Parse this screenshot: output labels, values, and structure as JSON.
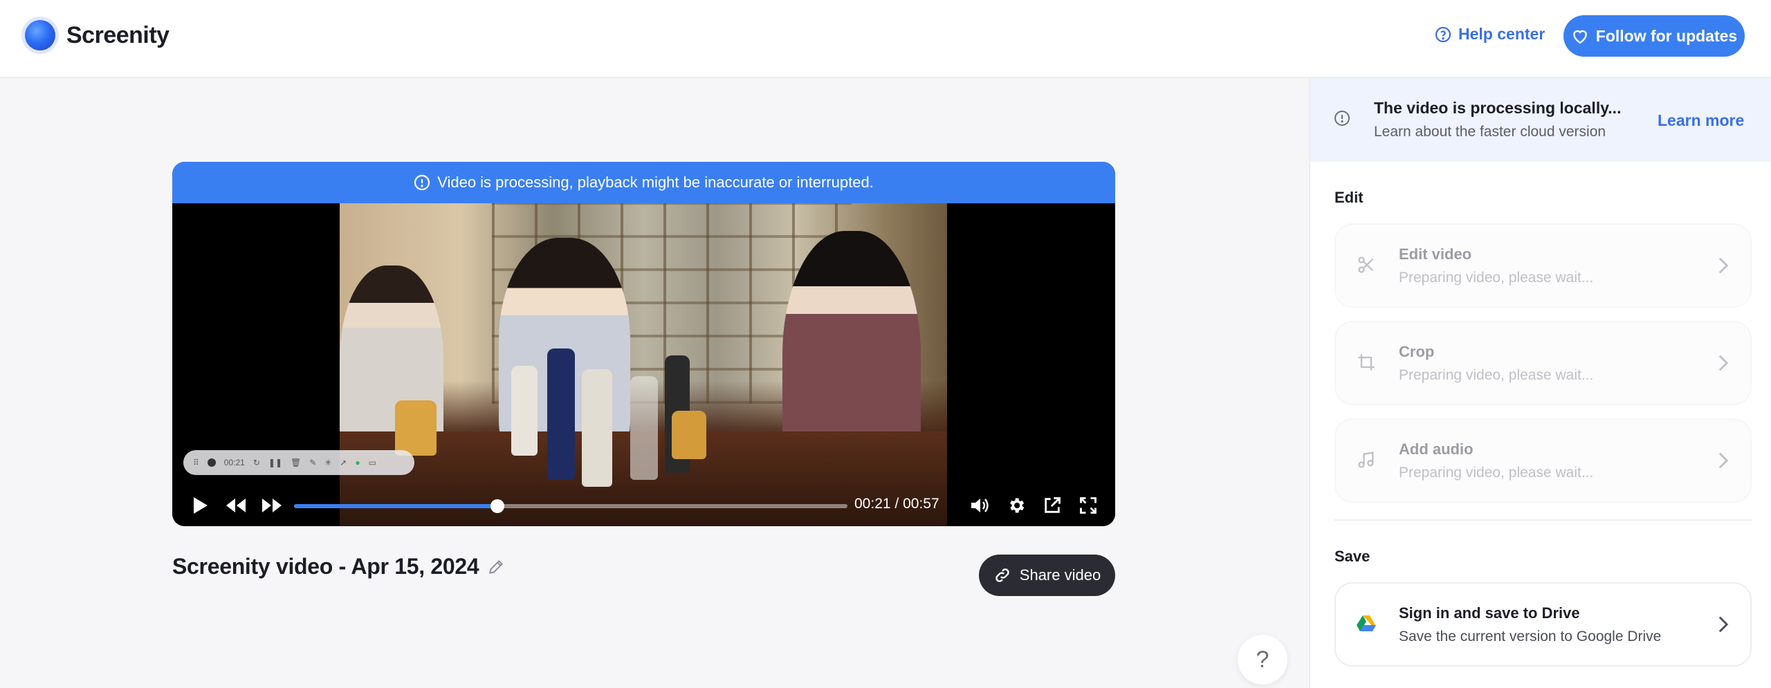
{
  "header": {
    "app_name": "Screenity",
    "help_label": "Help center",
    "follow_label": "Follow for updates"
  },
  "player": {
    "processing_banner": "Video is processing, playback might be inaccurate or interrupted.",
    "current_time": "00:21",
    "separator": "/",
    "duration": "00:57",
    "progress_fraction": 0.368,
    "recorder_toolbar_time": "00:21"
  },
  "video": {
    "title": "Screenity video - Apr 15, 2024",
    "share_label": "Share video"
  },
  "help_fab": {
    "label": "?"
  },
  "sidebar": {
    "notice": {
      "title": "The video is processing locally...",
      "subtitle": "Learn about the faster cloud version",
      "link_label": "Learn more"
    },
    "edit_section_label": "Edit",
    "edit_items": [
      {
        "title": "Edit video",
        "subtitle": "Preparing video, please wait...",
        "icon": "scissors-icon"
      },
      {
        "title": "Crop",
        "subtitle": "Preparing video, please wait...",
        "icon": "crop-icon"
      },
      {
        "title": "Add audio",
        "subtitle": "Preparing video, please wait...",
        "icon": "music-note-icon"
      }
    ],
    "save_section_label": "Save",
    "save_items": [
      {
        "title": "Sign in and save to Drive",
        "subtitle": "Save the current version to Google Drive",
        "icon": "google-drive-icon"
      }
    ]
  },
  "colors": {
    "accent": "#3a7ff1",
    "link": "#3a6fe6",
    "share_button": "#2b2c33",
    "notice_bg": "#eef3fd"
  }
}
